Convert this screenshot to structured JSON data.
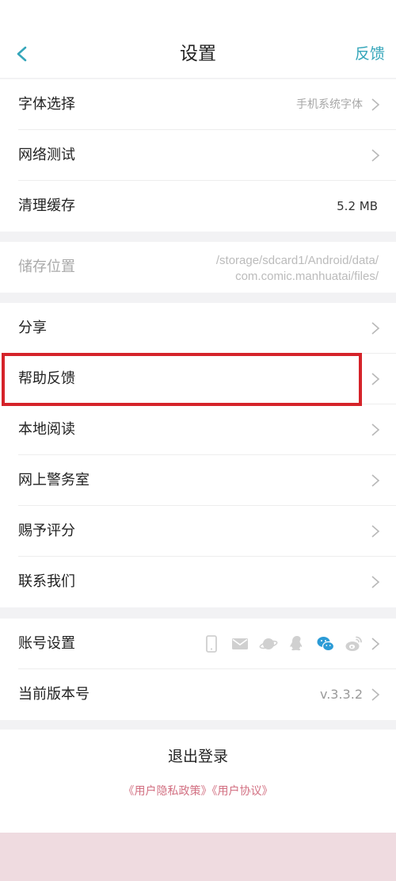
{
  "header": {
    "back_icon": "chevron-left-icon",
    "title": "设置",
    "feedback_label": "反馈",
    "accent_color": "#35a6ba"
  },
  "section1": [
    {
      "label": "字体选择",
      "value": "手机系统字体",
      "chevron": true
    },
    {
      "label": "网络测试",
      "value": "",
      "chevron": true
    },
    {
      "label": "清理缓存",
      "value": "5.2 MB",
      "chevron": false
    }
  ],
  "storage": {
    "label": "储存位置",
    "path_line1": "/storage/sdcard1/Android/data/",
    "path_line2": "com.comic.manhuatai/files/"
  },
  "section2": [
    {
      "label": "分享"
    },
    {
      "label": "帮助反馈",
      "highlighted": true
    },
    {
      "label": "本地阅读"
    },
    {
      "label": "网上警务室"
    },
    {
      "label": "赐予评分"
    },
    {
      "label": "联系我们"
    }
  ],
  "section3": {
    "account": {
      "label": "账号设置",
      "icons": [
        "phone-icon",
        "mail-icon",
        "planet-icon",
        "qq-icon",
        "wechat-icon",
        "weibo-icon"
      ],
      "active_icon": "wechat-icon"
    },
    "version": {
      "label": "当前版本号",
      "value": "v.3.3.2"
    }
  },
  "footer": {
    "logout_label": "退出登录",
    "privacy_link": "《用户隐私政策》",
    "agreement_link": "《用户协议》"
  },
  "colors": {
    "highlight_border": "#d5232a",
    "link_pink": "#d27082",
    "section_gap": "#f2f2f4"
  }
}
